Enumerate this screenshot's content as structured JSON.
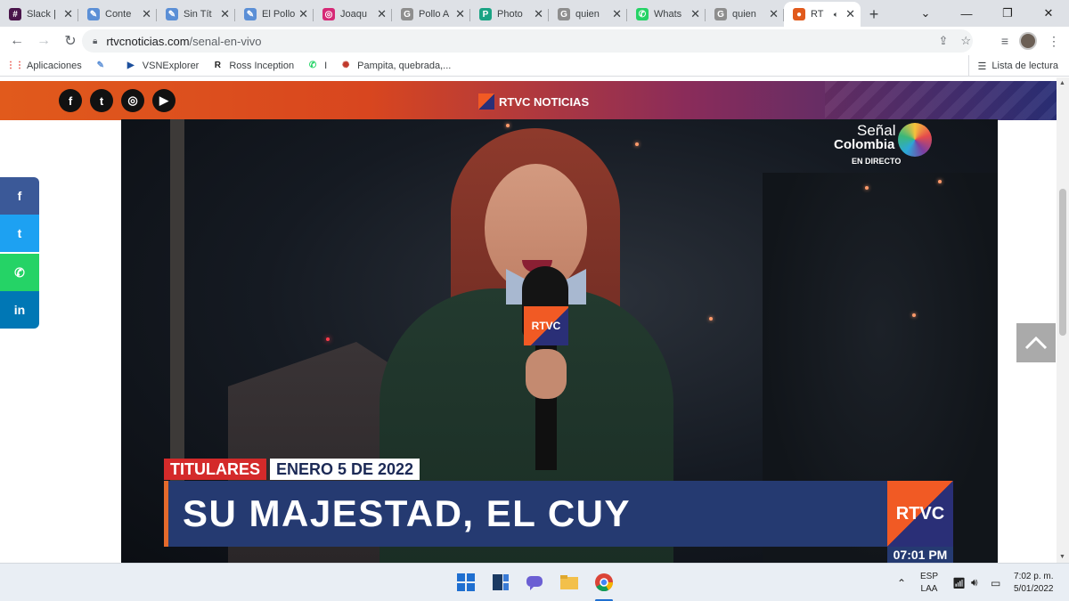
{
  "browser": {
    "tabs": [
      {
        "title": "Slack |",
        "color": "#4a154b",
        "glyph": "#"
      },
      {
        "title": "Conte",
        "color": "#5b8fd6",
        "glyph": "✎"
      },
      {
        "title": "Sin Tít",
        "color": "#5b8fd6",
        "glyph": "✎"
      },
      {
        "title": "El Pollo",
        "color": "#5b8fd6",
        "glyph": "✎"
      },
      {
        "title": "Joaqu",
        "color": "#d62976",
        "glyph": "◎"
      },
      {
        "title": "Pollo A",
        "color": "#8e8e8e",
        "glyph": "G"
      },
      {
        "title": "Photo",
        "color": "#1aa384",
        "glyph": "P"
      },
      {
        "title": "quien",
        "color": "#8e8e8e",
        "glyph": "G"
      },
      {
        "title": "Whats",
        "color": "#25d366",
        "glyph": "✆"
      },
      {
        "title": "quien",
        "color": "#8e8e8e",
        "glyph": "G"
      },
      {
        "title": "RT",
        "color": "#e15a1c",
        "glyph": "●",
        "active": true
      }
    ],
    "url_host": "rtvcnoticias.com",
    "url_path": "/senal-en-vivo",
    "bookmarks": [
      {
        "label": "Aplicaciones",
        "glyph": "⋮⋮",
        "color": "#e8453c"
      },
      {
        "label": "",
        "glyph": "✎",
        "color": "#5b8fd6"
      },
      {
        "label": "VSNExplorer",
        "glyph": "▶",
        "color": "#1b4f9c"
      },
      {
        "label": "Ross Inception",
        "glyph": "R",
        "color": "#222222"
      },
      {
        "label": "I",
        "glyph": "✆",
        "color": "#25d366"
      },
      {
        "label": "Pampita, quebrada,...",
        "glyph": "✺",
        "color": "#c0392b"
      }
    ],
    "reading_list": "Lista de lectura"
  },
  "site": {
    "brand": "RTVC NOTICIAS",
    "social": [
      "f",
      "t",
      "◎",
      "▶"
    ],
    "share": [
      {
        "glyph": "f",
        "color": "#3b5998"
      },
      {
        "glyph": "t",
        "color": "#1da1f2"
      },
      {
        "glyph": "✆",
        "color": "#25d366"
      },
      {
        "glyph": "in",
        "color": "#0077b5"
      }
    ]
  },
  "video": {
    "channel_line1": "Señal",
    "channel_line2": "Colombia",
    "channel_live": "EN DIRECTO",
    "mic_label": "RTVC",
    "tag_section": "TITULARES",
    "tag_date": "ENERO 5 DE 2022",
    "headline": "SU MAJESTAD, EL CUY",
    "corner_logo": "RTVC",
    "clock": "07:01 PM"
  },
  "taskbar": {
    "lang_1": "ESP",
    "lang_2": "LAA",
    "time": "7:02 p. m.",
    "date": "5/01/2022"
  },
  "colors": {
    "header_orange": "#e15a1c",
    "header_navy": "#2a2f77",
    "lower_third": "#253a71",
    "tag_red": "#d42a2a"
  }
}
